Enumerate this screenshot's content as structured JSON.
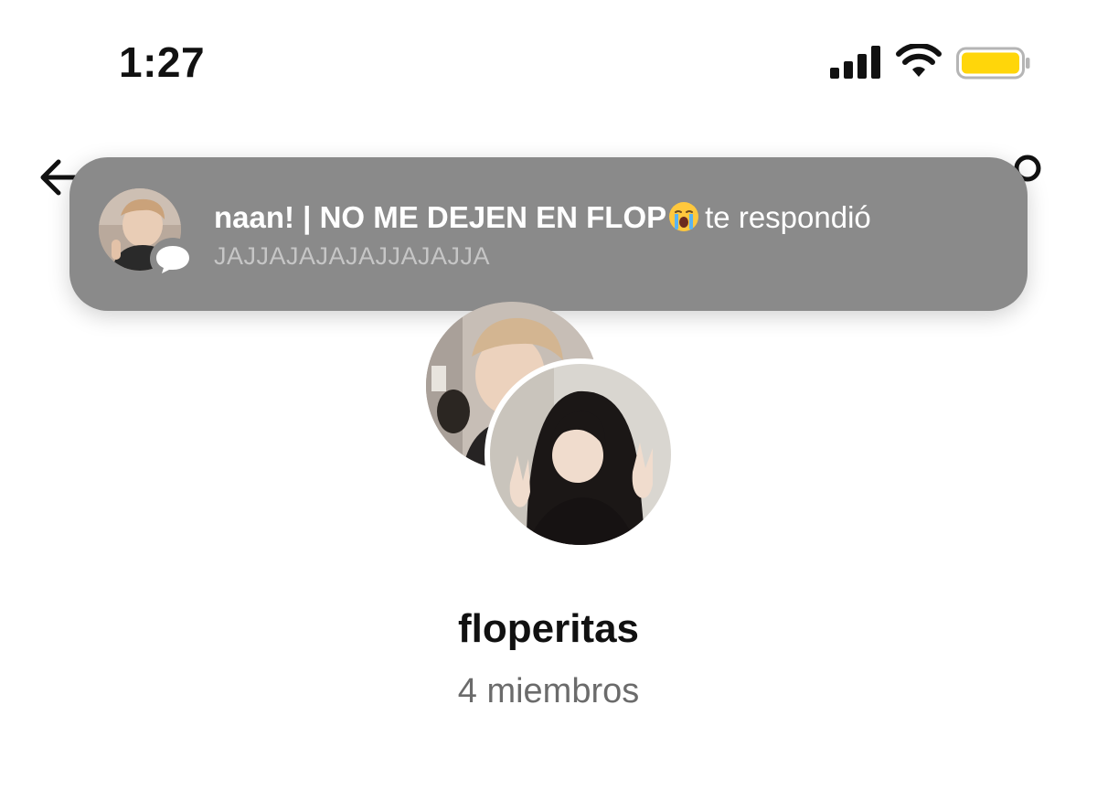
{
  "status_bar": {
    "time": "1:27",
    "icons": [
      "signal-icon",
      "wifi-icon",
      "battery-icon"
    ],
    "battery_color": "#FFD60A"
  },
  "nav": {
    "back_icon": "back-arrow-icon",
    "right_icon": "nav-right-icon"
  },
  "notification": {
    "username": "naan! | NO ME DEJEN EN FLOP",
    "emoji": "crying-emoji-icon",
    "action": "te respondió",
    "message": "JAJJAJAJAJAJJAJAJJA",
    "background": "#8A8A8A"
  },
  "group": {
    "name": "floperitas",
    "members": "4 miembros"
  }
}
